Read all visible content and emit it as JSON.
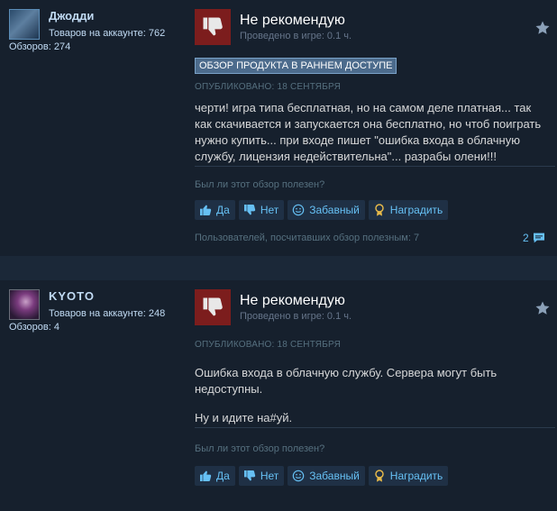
{
  "reviews": [
    {
      "author": {
        "name": "Джодди",
        "products": "Товаров на аккаунте: 762",
        "reviews": "Обзоров: 274"
      },
      "verdict": "Не рекомендую",
      "playtime": "Проведено в игре: 0.1 ч.",
      "early_access_badge": "ОБЗОР ПРОДУКТА В РАННЕМ ДОСТУПЕ",
      "published": "ОПУБЛИКОВАНО: 18 СЕНТЯБРЯ",
      "body": [
        "черти! игра типа бесплатная, но на самом деле платная... так как скачивается и запускается она бесплатно, но чтоб поиграть нужно купить... при входе пишет \"ошибка входа в облачную службу, лицензия недействительна\"... разрабы олени!!!"
      ],
      "helpful_question": "Был ли этот обзор полезен?",
      "buttons": {
        "yes": "Да",
        "no": "Нет",
        "funny": "Забавный",
        "award": "Наградить"
      },
      "helpful_count": "Пользователей, посчитавших обзор полезным: 7",
      "comments_count": "2"
    },
    {
      "author": {
        "name": "KYOTO",
        "products": "Товаров на аккаунте: 248",
        "reviews": "Обзоров: 4"
      },
      "verdict": "Не рекомендую",
      "playtime": "Проведено в игре: 0.1 ч.",
      "published": "ОПУБЛИКОВАНО: 18 СЕНТЯБРЯ",
      "body": [
        "Ошибка входа в облачную службу. Сервера могут быть недоступны.",
        "Ну и идите на#уй."
      ],
      "helpful_question": "Был ли этот обзор полезен?",
      "buttons": {
        "yes": "Да",
        "no": "Нет",
        "funny": "Забавный",
        "award": "Наградить"
      }
    }
  ],
  "colors": {
    "background": "#1b2838",
    "card": "#16202d",
    "thumb_down_bg": "#7c1d1d",
    "link": "#66c0f4"
  },
  "icons": [
    "thumbs-down-icon",
    "star-icon",
    "thumbs-up-icon",
    "smile-icon",
    "award-icon",
    "comment-icon"
  ]
}
